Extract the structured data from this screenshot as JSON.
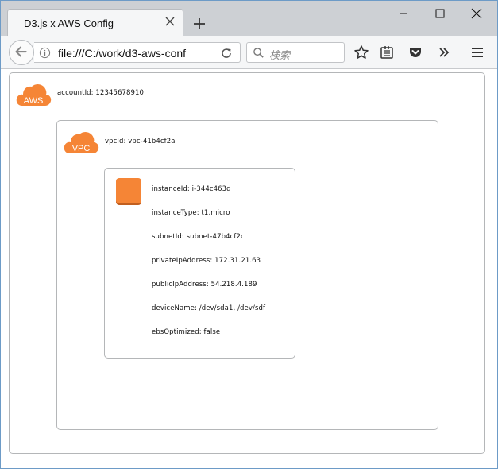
{
  "browser": {
    "tab": {
      "title": "D3.js x AWS Config"
    },
    "url": "file:///C:/work/d3-aws-conf",
    "search_placeholder": "検索"
  },
  "diagram": {
    "account": {
      "badge": "AWS",
      "label": "accountId: 12345678910"
    },
    "vpc": {
      "badge": "VPC",
      "label": "vpcId: vpc-41b4cf2a"
    },
    "instance": {
      "fields": [
        "instanceId: i-344c463d",
        "instanceType: t1.micro",
        "subnetId: subnet-47b4cf2c",
        "privateIpAddress: 172.31.21.63",
        "publicIpAddress: 54.218.4.189",
        "deviceName: /dev/sda1, /dev/sdf",
        "ebsOptimized: false"
      ]
    }
  },
  "colors": {
    "aws_orange": "#f58536",
    "tabstrip": "#cdd0d4",
    "toolbar": "#f5f6f7"
  },
  "icons": [
    "back-arrow-icon",
    "info-icon",
    "reload-icon",
    "search-icon",
    "star-icon",
    "reading-list-icon",
    "pocket-icon",
    "overflow-chevron-icon",
    "hamburger-menu-icon",
    "close-icon",
    "plus-icon",
    "minimize-icon",
    "maximize-icon"
  ]
}
